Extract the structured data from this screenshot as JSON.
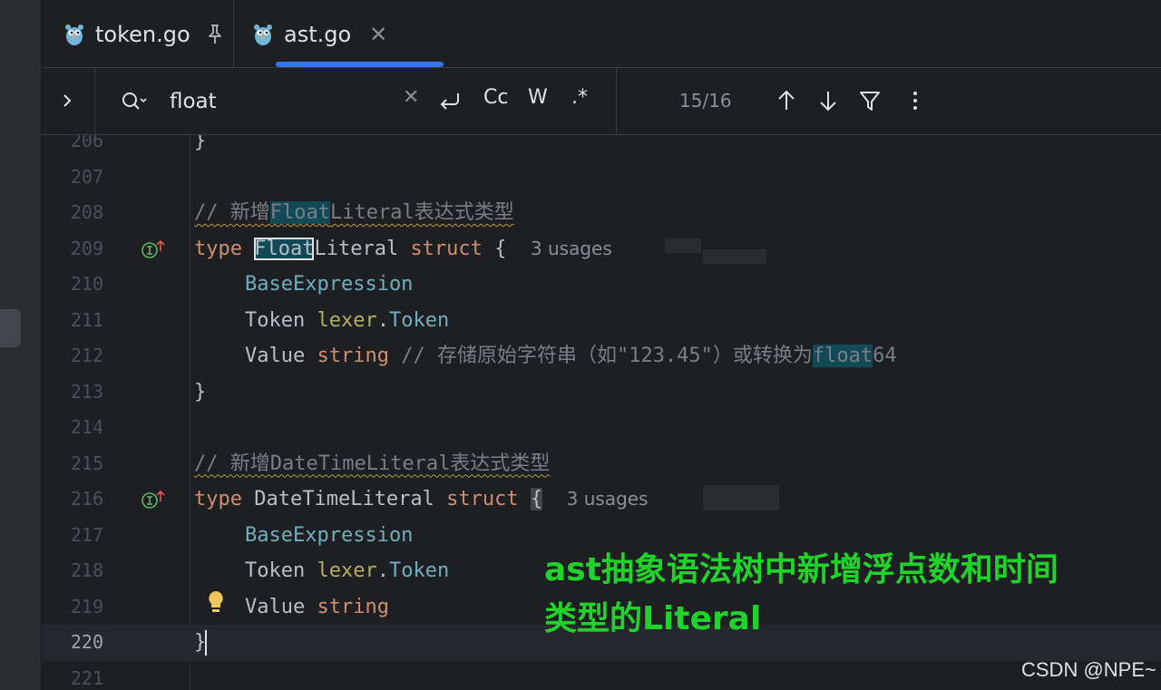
{
  "tabs": [
    {
      "label": "token.go",
      "pinned": true,
      "active": false
    },
    {
      "label": "ast.go",
      "pinned": false,
      "active": true
    }
  ],
  "search": {
    "query": "float",
    "options": {
      "match_case": "Cc",
      "words": "W",
      "regex": ".*"
    },
    "match_count": "15/16"
  },
  "editor": {
    "current_line": "220",
    "lines": [
      {
        "num": "206",
        "text": "}"
      },
      {
        "num": "207",
        "text": ""
      },
      {
        "num": "208",
        "comment_prefix": "// 新增",
        "match": "Float",
        "comment_suffix": "Literal表达式类型"
      },
      {
        "num": "209",
        "kw": "type",
        "match": "Float",
        "name_rest": "Literal",
        "kw2": "struct",
        "brace": "{",
        "hint": "3 usages"
      },
      {
        "num": "210",
        "text": "BaseExpression"
      },
      {
        "num": "211",
        "field": "Token",
        "pkg": "lexer",
        "type": "Token"
      },
      {
        "num": "212",
        "field": "Value",
        "type": "string",
        "comment_prefix": "// 存储原始字符串（如\"123.45\"）或转换为",
        "match": "float",
        "comment_suffix": "64"
      },
      {
        "num": "213",
        "text": "}"
      },
      {
        "num": "214",
        "text": ""
      },
      {
        "num": "215",
        "comment": "// 新增DateTimeLiteral表达式类型"
      },
      {
        "num": "216",
        "kw": "type",
        "name": "DateTimeLiteral",
        "kw2": "struct",
        "brace": "{",
        "hint": "3 usages"
      },
      {
        "num": "217",
        "text": "BaseExpression"
      },
      {
        "num": "218",
        "field": "Token",
        "pkg": "lexer",
        "type": "Token"
      },
      {
        "num": "219",
        "field": "Value",
        "type": "string"
      },
      {
        "num": "220",
        "text": "}"
      },
      {
        "num": "221",
        "text": ""
      }
    ]
  },
  "annotation": {
    "line1": "ast抽象语法树中新增浮点数和时间",
    "line2": "类型的Literal",
    "color": "#1fd32b"
  },
  "watermark": "CSDN @NPE~",
  "colors": {
    "accent": "#3574f0",
    "keyword": "#cf8e6d",
    "search_highlight": "#114957"
  }
}
